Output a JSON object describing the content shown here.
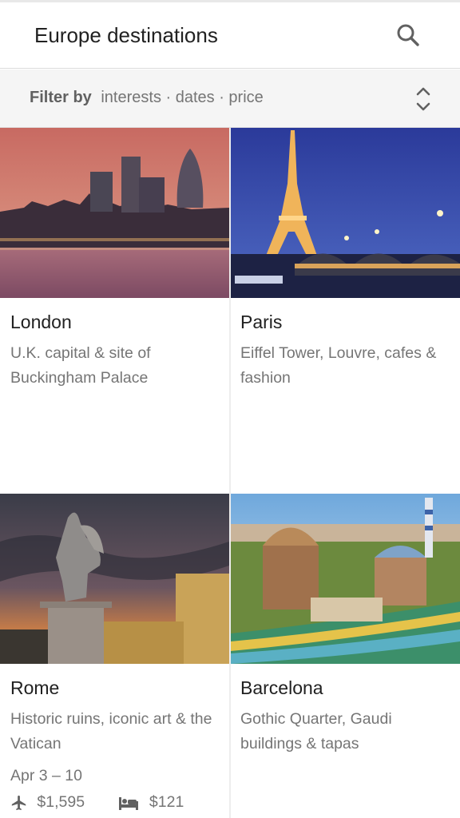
{
  "header": {
    "title": "Europe destinations",
    "search_icon": "search-icon"
  },
  "filter": {
    "label": "Filter by",
    "options": "interests · dates · price",
    "expand_icon": "unfold-more-icon"
  },
  "destinations": [
    {
      "name": "London",
      "description": "U.K. capital & site of Buckingham Palace"
    },
    {
      "name": "Paris",
      "description": "Eiffel Tower, Louvre, cafes & fashion"
    },
    {
      "name": "Rome",
      "description": "Historic ruins, iconic art & the Vatican",
      "dates": "Apr 3 – 10",
      "flight_price": "$1,595",
      "hotel_price": "$121",
      "flight_icon": "airplane-icon",
      "hotel_icon": "bed-icon"
    },
    {
      "name": "Barcelona",
      "description": "Gothic Quarter, Gaudi buildings & tapas"
    }
  ],
  "colors": {
    "divider": "#dcdcdc",
    "secondary_text": "#757575",
    "primary_text": "#212121"
  }
}
